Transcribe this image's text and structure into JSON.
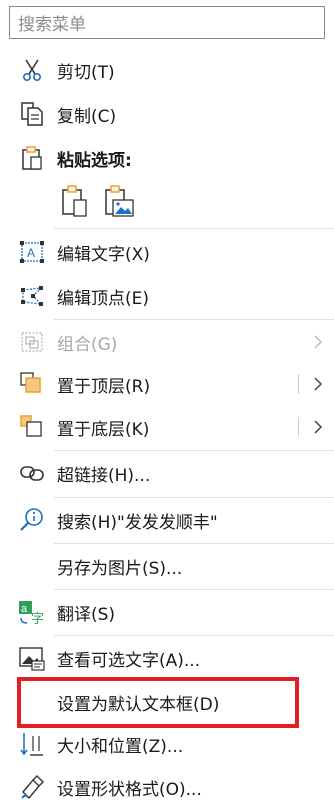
{
  "search": {
    "placeholder": "搜索菜单"
  },
  "items": {
    "cut": "剪切(T)",
    "copy": "复制(C)",
    "paste_options": "粘贴选项:",
    "edit_text": "编辑文字(X)",
    "edit_points": "编辑顶点(E)",
    "group": "组合(G)",
    "bring_front": "置于顶层(R)",
    "send_back": "置于底层(K)",
    "hyperlink": "超链接(H)...",
    "search_web": "搜索(H)\"发发发顺丰\"",
    "save_as_picture": "另存为图片(S)...",
    "translate": "翻译(S)",
    "alt_text": "查看可选文字(A)...",
    "set_default_textbox": "设置为默认文本框(D)",
    "size_position": "大小和位置(Z)...",
    "format_shape": "设置形状格式(O)..."
  },
  "colors": {
    "accent_blue": "#1e6fc5",
    "highlight_red": "#e01f26",
    "disabled_gray": "#a8a8a8",
    "icon_orange": "#e8a33a"
  }
}
